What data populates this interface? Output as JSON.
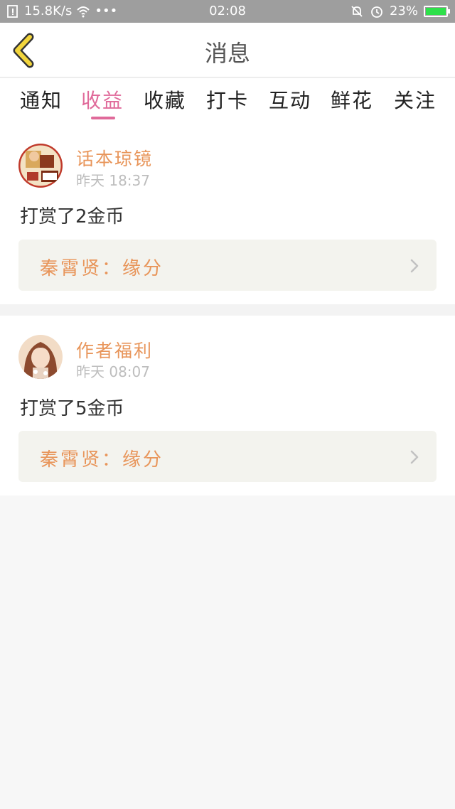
{
  "status_bar": {
    "net_speed": "15.8K/s",
    "dots": "•••",
    "time": "02:08",
    "battery": "23%"
  },
  "header": {
    "title": "消息"
  },
  "tabs": [
    {
      "label": "通知"
    },
    {
      "label": "收益"
    },
    {
      "label": "收藏"
    },
    {
      "label": "打卡"
    },
    {
      "label": "互动"
    },
    {
      "label": "鲜花"
    },
    {
      "label": "关注"
    }
  ],
  "messages": [
    {
      "sender": "话本琼镜",
      "time": "昨天 18:37",
      "text": "打赏了2金币",
      "ref": "秦霄贤：缘分"
    },
    {
      "sender": "作者福利",
      "time": "昨天 08:07",
      "text": "打赏了5金币",
      "ref": "秦霄贤：缘分"
    }
  ],
  "colors": {
    "accent_pink": "#e06a9a",
    "name_orange": "#e8955a",
    "back_yellow": "#f2d53c"
  }
}
